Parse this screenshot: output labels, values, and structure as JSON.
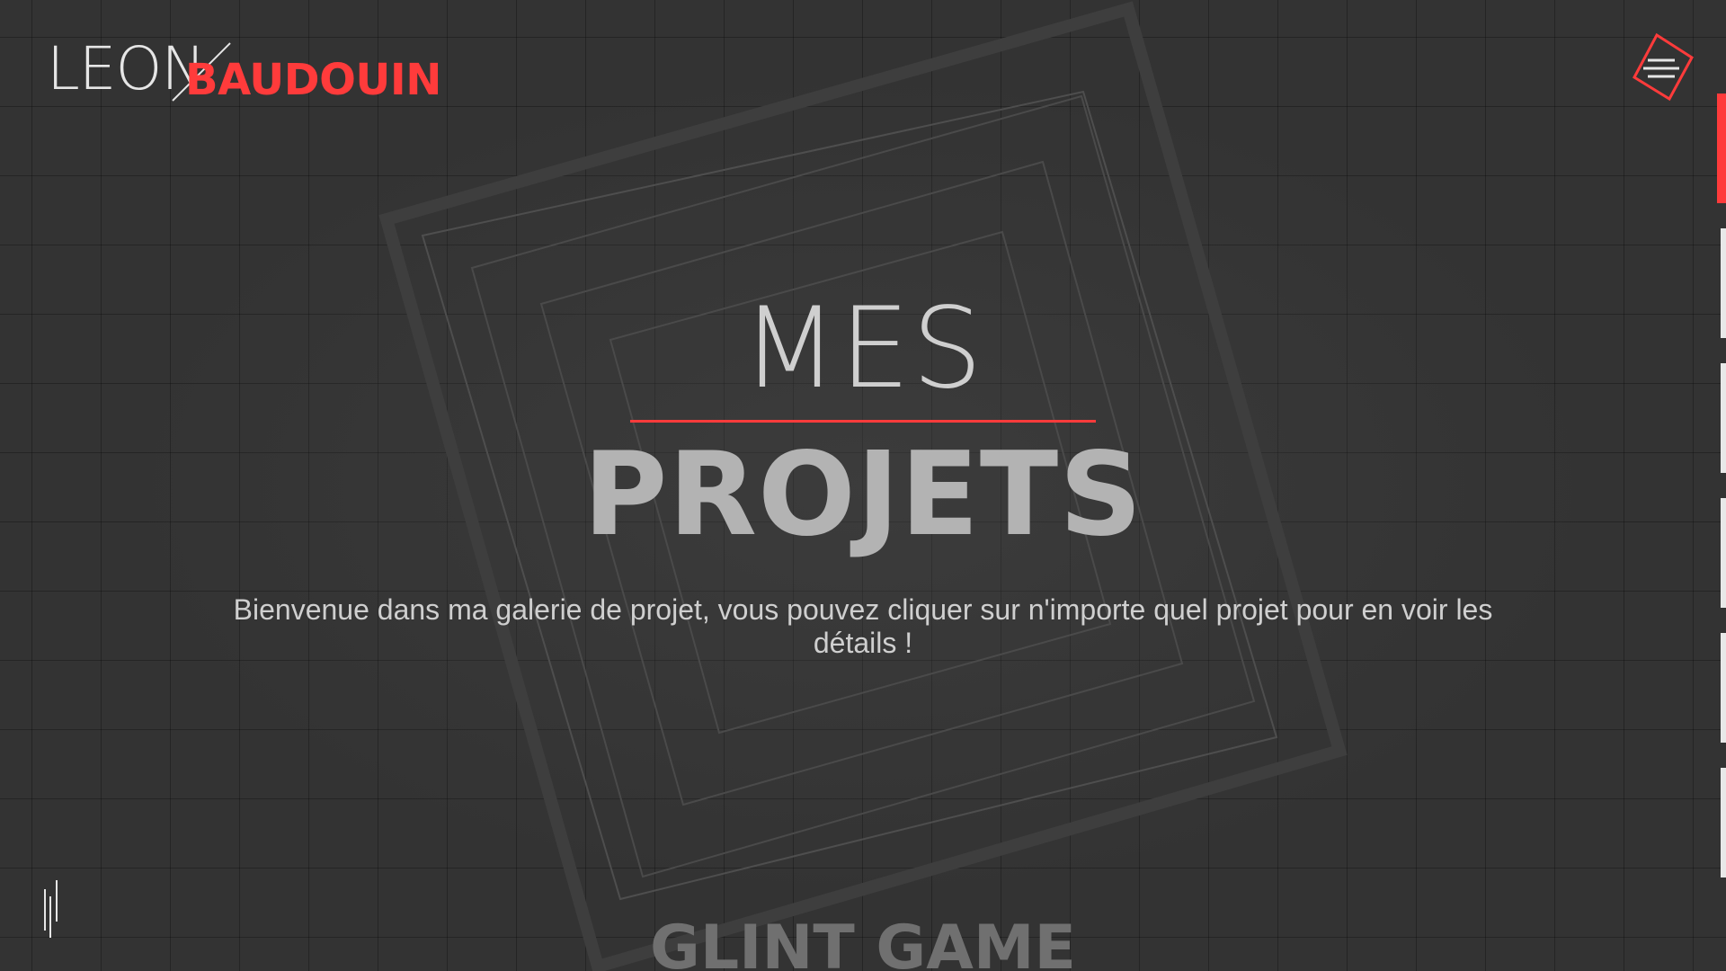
{
  "logo": {
    "first_name": "LEON",
    "last_name": "BAUDOUIN"
  },
  "menu": {
    "icon": "hamburger-icon"
  },
  "side_nav": {
    "sections": 6,
    "active_index": 0
  },
  "hero": {
    "title_top": "MES",
    "title_bottom": "PROJETS",
    "subtitle": "Bienvenue dans ma galerie de projet, vous pouvez cliquer sur n'importe quel projet pour en voir les détails !"
  },
  "projects": {
    "first_title": "GLINT GAME"
  },
  "colors": {
    "background": "#333333",
    "accent": "#ff3b3b",
    "text_light": "#cfcfcf",
    "text_muted": "#b3b3b3"
  }
}
